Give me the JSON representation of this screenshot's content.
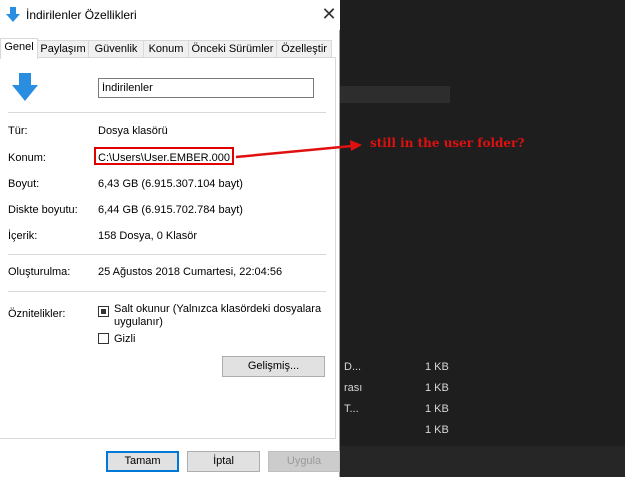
{
  "window": {
    "title": "İndirilenler Özellikleri",
    "close_glyph": "✕"
  },
  "tabs": [
    {
      "label": "Genel",
      "active": true
    },
    {
      "label": "Paylaşım"
    },
    {
      "label": "Güvenlik"
    },
    {
      "label": "Konum"
    },
    {
      "label": "Önceki Sürümler"
    },
    {
      "label": "Özelleştir"
    }
  ],
  "general": {
    "folder_name": "İndirilenler",
    "rows": [
      {
        "label": "Tür:",
        "value": "Dosya klasörü"
      },
      {
        "label": "Konum:",
        "value": "C:\\Users\\User.EMBER.000"
      },
      {
        "label": "Boyut:",
        "value": "6,43 GB (6.915.307.104 bayt)"
      },
      {
        "label": "Diskte boyutu:",
        "value": "6,44 GB (6.915.702.784 bayt)"
      },
      {
        "label": "İçerik:",
        "value": "158 Dosya, 0 Klasör"
      }
    ],
    "created_label": "Oluşturulma:",
    "created_value": "25 Ağustos 2018 Cumartesi, 22:04:56",
    "attributes_label": "Öznitelikler:",
    "readonly_label": "Salt okunur (Yalnızca klasördeki dosyalara uygulanır)",
    "readonly_state": "indeterminate",
    "hidden_label": "Gizli",
    "hidden_checked": false,
    "advanced_button": "Gelişmiş..."
  },
  "buttons": {
    "ok": "Tamam",
    "cancel": "İptal",
    "apply": "Uygula"
  },
  "annotation": {
    "text": "still in the user folder?",
    "color": "#e01010"
  },
  "background_list": [
    {
      "name": "D...",
      "size": "1 KB"
    },
    {
      "name": "rası",
      "size": "1 KB"
    },
    {
      "name": "T...",
      "size": "1 KB"
    },
    {
      "name": "",
      "size": "1 KB"
    }
  ],
  "colors": {
    "accent": "#0078d7",
    "folder_icon": "#2a8ee0"
  }
}
